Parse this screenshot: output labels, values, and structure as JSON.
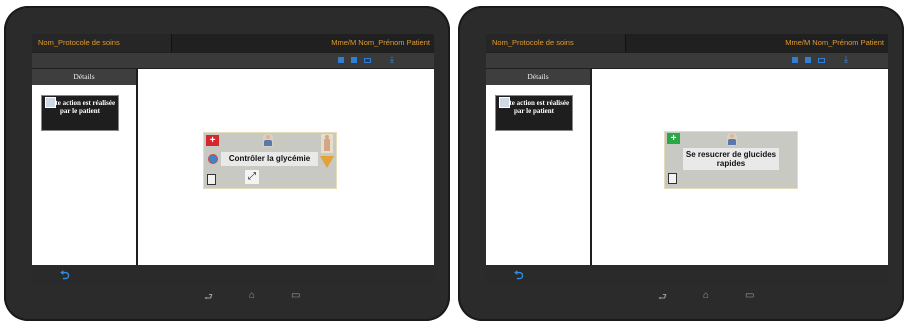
{
  "left_screen": {
    "header": {
      "protocol_label": "Nom_Protocole de soins",
      "patient_label": "Mme/M Nom_Prénom Patient"
    },
    "sidebar": {
      "title": "Détails",
      "action_text": "Cette action est réalisée par le patient"
    },
    "node": {
      "label": "Contrôler la glycémie"
    },
    "icons": {
      "cross": "+",
      "syringe": "⤢",
      "warning": "?"
    }
  },
  "right_screen": {
    "header": {
      "protocol_label": "Nom_Protocole de soins",
      "patient_label": "Mme/M Nom_Prénom Patient"
    },
    "sidebar": {
      "title": "Détails",
      "action_text": "Cette action est réalisée par le patient"
    },
    "node": {
      "label": "Se resucrer de glucides rapides"
    },
    "icons": {
      "cross": "+"
    }
  },
  "nav": {
    "back_glyph": "⮌",
    "nav_back": "⮐",
    "nav_home": "⌂",
    "nav_recent": "▭",
    "download_glyph": "⤓"
  }
}
